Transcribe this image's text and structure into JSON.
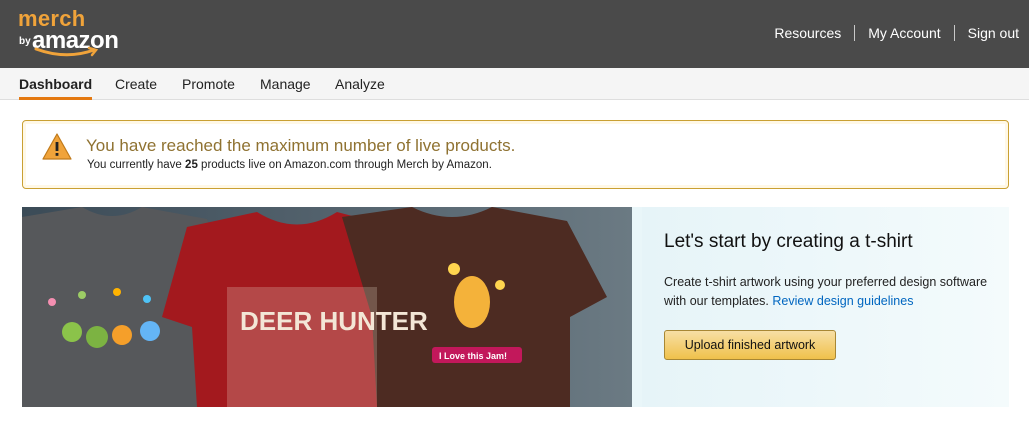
{
  "header": {
    "logo_merch": "merch",
    "logo_by": "by",
    "logo_amazon": "amazon",
    "links": [
      "Resources",
      "My Account",
      "Sign out"
    ]
  },
  "nav": {
    "tabs": [
      "Dashboard",
      "Create",
      "Promote",
      "Manage",
      "Analyze"
    ],
    "active": "Dashboard"
  },
  "alert": {
    "icon": "warning-triangle-icon",
    "title": "You have reached the maximum number of live products.",
    "desc_prefix": "You currently have",
    "count": "25",
    "desc_suffix": "products live on Amazon.com through Merch by Amazon."
  },
  "banner": {
    "shirt_text_1": "DEER HUNTER",
    "shirt_text_2": "I Love this Jam!",
    "heading": "Let's start by creating a t-shirt",
    "body_prefix": "Create t-shirt artwork using your preferred design software with our templates.",
    "body_link": "Review design guidelines",
    "button": "Upload finished artwork"
  },
  "colors": {
    "header_bg": "#4a4a4a",
    "accent": "#e47911",
    "alert_border": "#c9a033",
    "link": "#0066c0",
    "button": "#f0c14b"
  }
}
